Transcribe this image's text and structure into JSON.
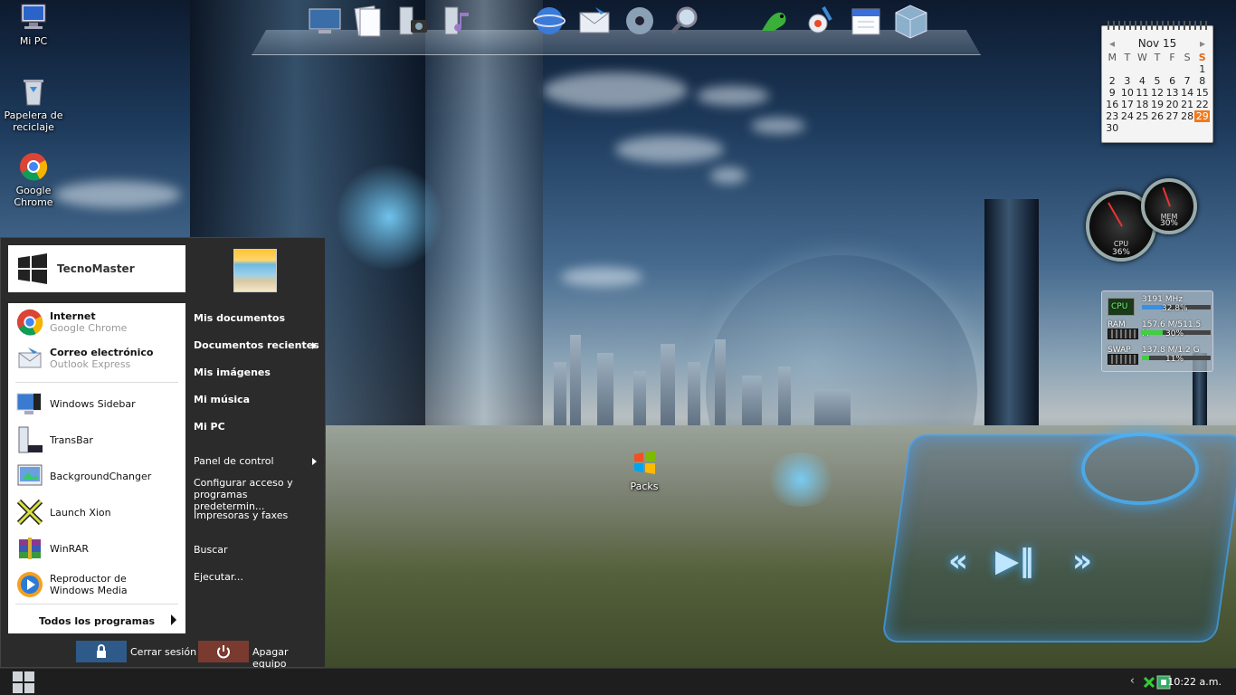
{
  "desktop": {
    "icons": [
      {
        "label": "Mi PC",
        "icon": "computer-icon"
      },
      {
        "label": "Papelera de reciclaje",
        "icon": "recycle-bin-icon"
      },
      {
        "label": "Google Chrome",
        "icon": "chrome-icon"
      },
      {
        "label": "Packs",
        "icon": "windows-logo-icon"
      }
    ]
  },
  "dock": {
    "items": [
      "monitor-icon",
      "documents-icon",
      "pictures-icon",
      "music-icon",
      "internet-globe-icon",
      "mail-icon",
      "media-player-icon",
      "search-icon",
      "gecko-icon",
      "settings-icon",
      "calendar-icon",
      "system-box-icon"
    ]
  },
  "calendar": {
    "month_label": "Nov 15",
    "day_names": [
      "M",
      "T",
      "W",
      "T",
      "F",
      "S",
      "S"
    ],
    "weeks": [
      [
        "",
        "",
        "",
        "",
        "",
        "",
        "1"
      ],
      [
        "2",
        "3",
        "4",
        "5",
        "6",
        "7",
        "8"
      ],
      [
        "9",
        "10",
        "11",
        "12",
        "13",
        "14",
        "15"
      ],
      [
        "16",
        "17",
        "18",
        "19",
        "20",
        "21",
        "22"
      ],
      [
        "23",
        "24",
        "25",
        "26",
        "27",
        "28",
        "29"
      ],
      [
        "30",
        "",
        "",
        "",
        "",
        "",
        ""
      ]
    ],
    "today": "29"
  },
  "gauges": {
    "cpu_label": "CPU",
    "cpu_value": "36%",
    "mem_label": "MEM",
    "mem_value": "30%"
  },
  "sysmon": {
    "cpu_label": "CPU",
    "cpu_freq": "3191 MHz",
    "cpu_pct": "32.8%",
    "cpu_fill": 0.33,
    "ram_label": "RAM",
    "ram_usage": "157.6 M/511.5 M",
    "ram_pct": "30%",
    "ram_fill": 0.3,
    "swap_label": "SWAP",
    "swap_usage": "137.8 M/1.2 G",
    "swap_pct": "11%",
    "swap_fill": 0.11,
    "colors": {
      "cpu": "#3a8fe0",
      "ram": "#3fcf3f",
      "swap": "#3fcf3f"
    }
  },
  "start_menu": {
    "user_name": "TecnoMaster",
    "pinned": [
      {
        "title": "Internet",
        "subtitle": "Google Chrome",
        "icon": "chrome-icon"
      },
      {
        "title": "Correo electrónico",
        "subtitle": "Outlook Express",
        "icon": "outlook-icon"
      }
    ],
    "recent": [
      {
        "title": "Windows Sidebar",
        "icon": "sidebar-icon"
      },
      {
        "title": "TransBar",
        "icon": "transbar-icon"
      },
      {
        "title": "BackgroundChanger",
        "icon": "background-changer-icon"
      },
      {
        "title": "Launch Xion",
        "icon": "xion-icon"
      },
      {
        "title": "WinRAR",
        "icon": "winrar-icon"
      },
      {
        "title": "Reproductor de Windows Media",
        "icon": "media-player-icon"
      }
    ],
    "all_programs": "Todos los programas",
    "right_items": [
      {
        "label": "Mis documentos",
        "bold": true,
        "arrow": false
      },
      {
        "label": "Documentos recientes",
        "bold": true,
        "arrow": true
      },
      {
        "label": "Mis imágenes",
        "bold": true,
        "arrow": false
      },
      {
        "label": "Mi música",
        "bold": true,
        "arrow": false
      },
      {
        "label": "Mi PC",
        "bold": true,
        "arrow": false
      },
      {
        "label": "Panel de control",
        "bold": false,
        "arrow": true
      },
      {
        "label": "Configurar acceso y programas predetermin...",
        "bold": false,
        "arrow": false
      },
      {
        "label": "Impresoras y faxes",
        "bold": false,
        "arrow": false
      },
      {
        "label": "Buscar",
        "bold": false,
        "arrow": false
      },
      {
        "label": "Ejecutar...",
        "bold": false,
        "arrow": false
      }
    ],
    "logoff_label": "Cerrar sesión",
    "shutdown_label": "Apagar equipo",
    "colors": {
      "logoff": "#2e5a8a",
      "shutdown": "#7a3a30"
    }
  },
  "taskbar": {
    "clock": "10:22 a.m."
  }
}
